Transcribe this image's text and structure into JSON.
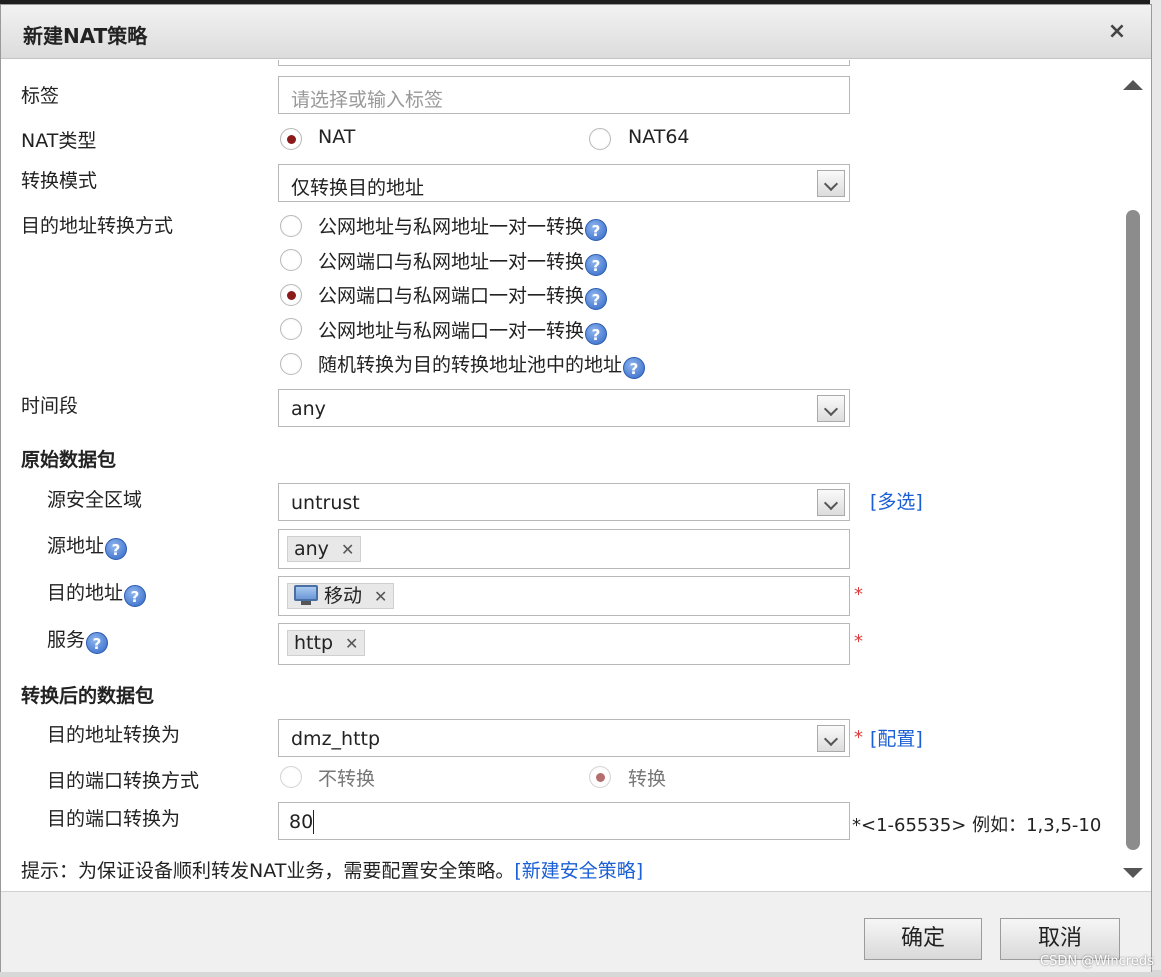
{
  "dialog": {
    "title": "新建NAT策略",
    "close_label": "×"
  },
  "form": {
    "tag": {
      "label": "标签",
      "placeholder": "请选择或输入标签"
    },
    "nat_type": {
      "label": "NAT类型",
      "options": [
        "NAT",
        "NAT64"
      ],
      "selected": "NAT"
    },
    "convert_mode": {
      "label": "转换模式",
      "value": "仅转换目的地址"
    },
    "dest_convert_method": {
      "label": "目的地址转换方式",
      "options": [
        "公网地址与私网地址一对一转换",
        "公网端口与私网地址一对一转换",
        "公网端口与私网端口一对一转换",
        "公网地址与私网端口一对一转换",
        "随机转换为目的转换地址池中的地址"
      ],
      "selected": "公网端口与私网端口一对一转换"
    },
    "time_range": {
      "label": "时间段",
      "value": "any"
    }
  },
  "original_packet": {
    "title": "原始数据包",
    "src_zone": {
      "label": "源安全区域",
      "value": "untrust",
      "link": "[多选]"
    },
    "src_addr": {
      "label": "源地址",
      "tag": "any"
    },
    "dst_addr": {
      "label": "目的地址",
      "tag": "移动",
      "required": "*"
    },
    "service": {
      "label": "服务",
      "tag": "http",
      "required": "*"
    }
  },
  "translated_packet": {
    "title": "转换后的数据包",
    "dst_addr_to": {
      "label": "目的地址转换为",
      "value": "dmz_http",
      "required": "*",
      "link": "[配置]"
    },
    "dst_port_method": {
      "label": "目的端口转换方式",
      "options": [
        "不转换",
        "转换"
      ],
      "selected": "转换"
    },
    "dst_port_to": {
      "label": "目的端口转换为",
      "value": "80",
      "hint": "*<1-65535> 例如：1,3,5-10"
    }
  },
  "notice": {
    "text": "提示：为保证设备顺利转发NAT业务，需要配置安全策略。",
    "link": "[新建安全策略]"
  },
  "footer": {
    "ok": "确定",
    "cancel": "取消"
  },
  "watermark": "CSDN @Wincreds",
  "help_glyph": "?",
  "remove_glyph": "✕",
  "icons": {
    "help": "help-circle-icon",
    "computer": "computer-icon",
    "remove": "close-icon"
  }
}
